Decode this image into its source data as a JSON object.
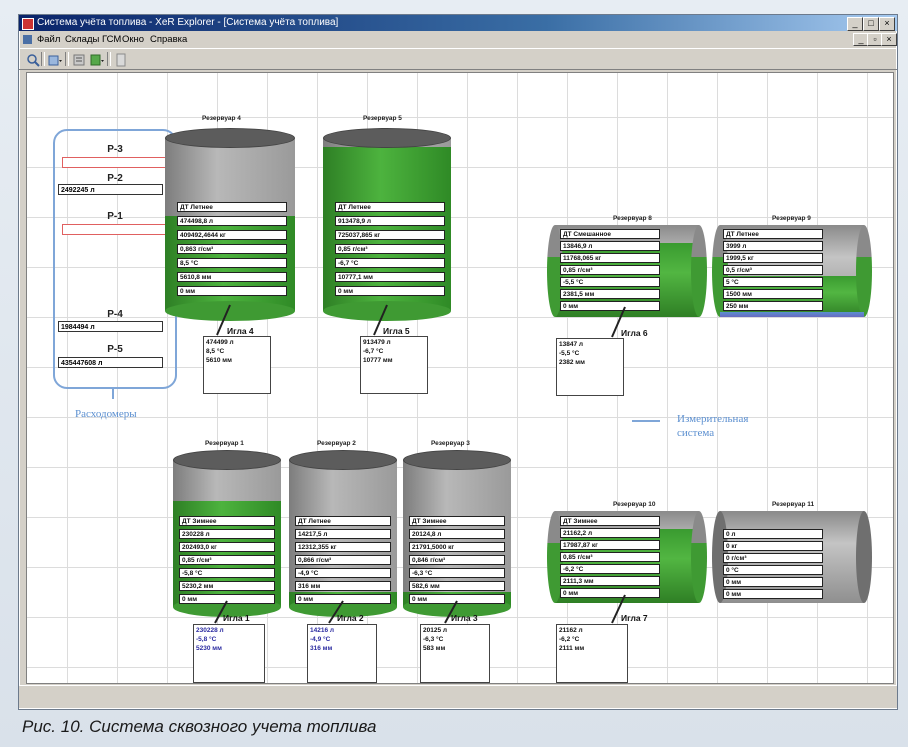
{
  "window": {
    "title": "Система учёта топлива - XeR Explorer - [Система учёта топлива]",
    "controls": {
      "minimize": "_",
      "maximize": "□",
      "close": "×"
    },
    "child_controls": {
      "minimize": "_",
      "restore": "▫",
      "close": "×"
    }
  },
  "menu": {
    "items": [
      "Файл",
      "Склады ГСМ",
      "Окно",
      "Справка"
    ]
  },
  "toolbar": {
    "buttons": [
      "zoom-icon",
      "open-dropdown-icon",
      "list-icon",
      "export-dropdown-icon",
      "panel-icon"
    ]
  },
  "flow_meters": {
    "caption": "Расходомеры",
    "meters": [
      {
        "label": "Р-3",
        "value": "",
        "state": "alarm"
      },
      {
        "label": "Р-2",
        "value": "2492245 л",
        "state": "ok"
      },
      {
        "label": "Р-1",
        "value": "",
        "state": "alarm"
      },
      {
        "label": "Р-4",
        "value": "1984494 л",
        "state": "ok"
      },
      {
        "label": "Р-5",
        "value": "435447608 л",
        "state": "ok"
      }
    ]
  },
  "measurement_system": {
    "caption_line1": "Измерительная",
    "caption_line2": "система"
  },
  "tanks": [
    {
      "id": "t4",
      "title": "Резервуар 4",
      "fill": 0.55,
      "rows": [
        "ДТ Летнее",
        "474498,8 л",
        "409492,4644 кг",
        "0,863 г/см³",
        "8,5 °С",
        "5610,8 мм",
        "0 мм"
      ]
    },
    {
      "id": "t5",
      "title": "Резервуар 5",
      "fill": 0.95,
      "rows": [
        "ДТ Летнее",
        "913478,9 л",
        "725037,865 кг",
        "0,85 г/см³",
        "-6,7 °С",
        "10777,1 мм",
        "0 мм"
      ]
    },
    {
      "id": "t8",
      "title": "Резервуар 8",
      "fill": 0.8,
      "rows": [
        "ДТ Смешанное",
        "13846,9 л",
        "11768,065 кг",
        "0,85 г/см³",
        "-5,5 °С",
        "2381,5 мм",
        "0 мм"
      ]
    },
    {
      "id": "t9",
      "title": "Резервуар 9",
      "fill": 0.45,
      "rows": [
        "ДТ Летнее",
        "3999 л",
        "1999,5 кг",
        "0,5 г/см³",
        "5 °С",
        "1500 мм",
        "250 мм"
      ]
    },
    {
      "id": "t1",
      "title": "Резервуар 1",
      "fill": 0.72,
      "rows": [
        "ДТ Зимнее",
        "230228 л",
        "202493,0 кг",
        "0,85 г/см³",
        "-5,8 °С",
        "5230,2 мм",
        "0 мм"
      ]
    },
    {
      "id": "t2",
      "title": "Резервуар 2",
      "fill": 0.1,
      "rows": [
        "ДТ Летнее",
        "14217,5 л",
        "12312,355 кг",
        "0,866 г/см³",
        "-4,9 °С",
        "316 мм",
        "0 мм"
      ]
    },
    {
      "id": "t3",
      "title": "Резервуар 3",
      "fill": 0.1,
      "rows": [
        "ДТ Зимнее",
        "20124,8 л",
        "21791,5000 кг",
        "0,846 г/см³",
        "-6,3 °С",
        "582,6 мм",
        "0 мм"
      ]
    },
    {
      "id": "t10",
      "title": "Резервуар 10",
      "fill": 0.8,
      "rows": [
        "ДТ Зимнее",
        "21162,2 л",
        "17987,87 кг",
        "0,85 г/см³",
        "-6,2 °С",
        "2111,3 мм",
        "0 мм"
      ]
    },
    {
      "id": "t11",
      "title": "Резервуар 11",
      "fill": 0.0,
      "rows": [
        "0 л",
        "0 кг",
        "0 г/см³",
        "0 °С",
        "0 мм",
        "0 мм"
      ]
    }
  ],
  "probes": [
    {
      "id": "p4",
      "name": "Игла 4",
      "values": [
        "474499 л",
        "8,5 °С",
        "5610 мм"
      ]
    },
    {
      "id": "p5",
      "name": "Игла 5",
      "values": [
        "913479 л",
        "-6,7 °С",
        "10777 мм"
      ]
    },
    {
      "id": "p6",
      "name": "Игла 6",
      "values": [
        "13847 л",
        "-5,5 °С",
        "2382 мм"
      ]
    },
    {
      "id": "p1",
      "name": "Игла 1",
      "values": [
        "230228 л",
        "-5,8 °С",
        "5230 мм"
      ]
    },
    {
      "id": "p2",
      "name": "Игла 2",
      "values": [
        "14216 л",
        "-4,9 °С",
        "316 мм"
      ]
    },
    {
      "id": "p3",
      "name": "Игла 3",
      "values": [
        "20125 л",
        "-6,3 °С",
        "583 мм"
      ]
    },
    {
      "id": "p7",
      "name": "Игла 7",
      "values": [
        "21162 л",
        "-6,2 °С",
        "2111 мм"
      ]
    }
  ],
  "caption": "Рис. 10. Система сквозного учета топлива"
}
